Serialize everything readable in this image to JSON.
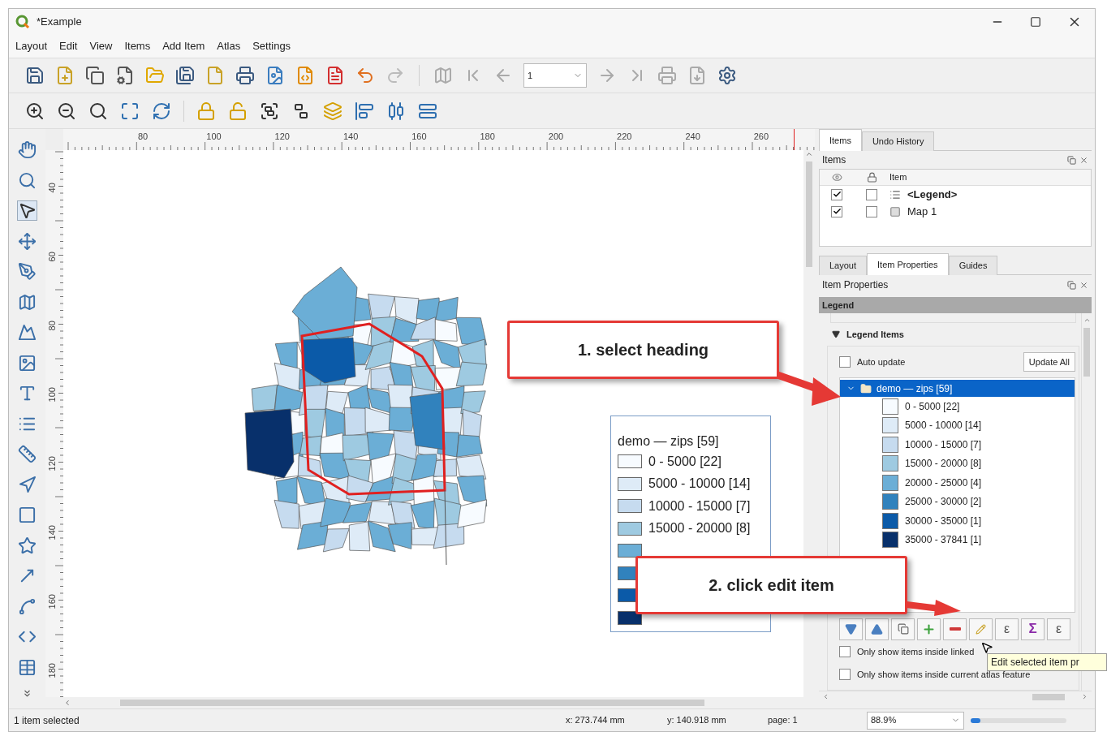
{
  "window": {
    "title": "*Example"
  },
  "menu": [
    "Layout",
    "Edit",
    "View",
    "Items",
    "Add Item",
    "Atlas",
    "Settings"
  ],
  "atlas_page": {
    "value": "1"
  },
  "rulers": {
    "horizontal": [
      "80",
      "100",
      "120",
      "140",
      "160",
      "180",
      "200",
      "220",
      "240",
      "260"
    ],
    "vertical": [
      "40",
      "60",
      "80",
      "100",
      "120",
      "140",
      "160",
      "180"
    ]
  },
  "canvas_legend": {
    "title": "demo — zips [59]",
    "items": [
      {
        "label": "0 - 5000 [22]",
        "color": "#f7fbff"
      },
      {
        "label": "5000 - 10000 [14]",
        "color": "#deebf7"
      },
      {
        "label": "10000 - 15000 [7]",
        "color": "#c6dbef"
      },
      {
        "label": "15000 - 20000 [8]",
        "color": "#9ecae1"
      },
      {
        "color": "#6baed6"
      },
      {
        "color": "#3182bd"
      },
      {
        "color": "#0b5aa8"
      },
      {
        "color": "#08306b"
      }
    ]
  },
  "callouts": [
    {
      "text": "1. select heading"
    },
    {
      "text": "2. click edit item"
    }
  ],
  "panel_tabs": [
    {
      "label": "Items",
      "selected": true
    },
    {
      "label": "Undo History",
      "selected": false
    }
  ],
  "items_panel": {
    "title": "Items",
    "column": "Item",
    "rows": [
      {
        "name": "<Legend>",
        "kind": "legend",
        "visible": true,
        "locked": false,
        "selected": true
      },
      {
        "name": "Map 1",
        "kind": "map",
        "visible": true,
        "locked": false,
        "selected": false
      }
    ]
  },
  "properties_tabs": [
    {
      "label": "Layout",
      "selected": false
    },
    {
      "label": "Item Properties",
      "selected": true
    },
    {
      "label": "Guides",
      "selected": false
    }
  ],
  "properties_panel": {
    "title": "Item Properties",
    "section": "Legend",
    "group": {
      "title": "Legend Items",
      "expanded": true
    },
    "auto_update": {
      "label": "Auto update",
      "checked": false
    },
    "update_button": "Update All",
    "tree": {
      "label": "demo — zips [59]",
      "selected": true,
      "expanded": true,
      "children": [
        {
          "label": "0 - 5000 [22]",
          "color": "#f7fbff"
        },
        {
          "label": "5000 - 10000 [14]",
          "color": "#deebf7"
        },
        {
          "label": "10000 - 15000 [7]",
          "color": "#c6dbef"
        },
        {
          "label": "15000 - 20000 [8]",
          "color": "#9ecae1"
        },
        {
          "label": "20000 - 25000 [4]",
          "color": "#6baed6"
        },
        {
          "label": "25000 - 30000 [2]",
          "color": "#3182bd"
        },
        {
          "label": "30000 - 35000 [1]",
          "color": "#0b5aa8"
        },
        {
          "label": "35000 - 37841 [1]",
          "color": "#08306b"
        }
      ]
    },
    "tree_buttons": [
      {
        "kind": "move-down"
      },
      {
        "kind": "move-up"
      },
      {
        "kind": "group"
      },
      {
        "kind": "add"
      },
      {
        "kind": "remove"
      },
      {
        "kind": "edit"
      },
      {
        "kind": "glyph",
        "text": "ε"
      },
      {
        "kind": "glyph",
        "text": "Σ"
      },
      {
        "kind": "glyph",
        "text": "ε"
      }
    ],
    "tooltip": "Edit selected item pr",
    "options": [
      {
        "label": "Only show items inside linked",
        "checked": false
      },
      {
        "label": "Only show items inside current atlas feature",
        "checked": false
      }
    ]
  },
  "status_bar": {
    "message": "1 item selected",
    "x": "x: 273.744 mm",
    "y": "y: 140.918 mm",
    "page": "page: 1",
    "zoom": "88.9%",
    "zoom_slider": {
      "level": 0.1
    }
  }
}
